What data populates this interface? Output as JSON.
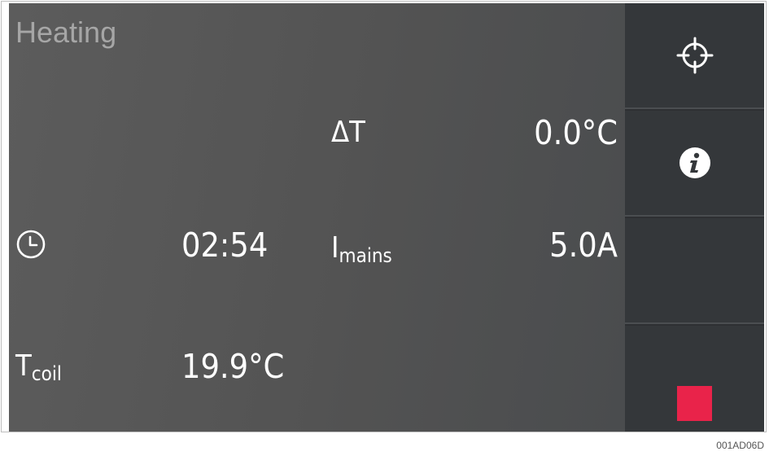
{
  "screen": {
    "title": "Heating",
    "delta_t": {
      "label": "ΔT",
      "value": "0.0°C"
    },
    "timer": {
      "icon": "clock-icon",
      "value": "02:54"
    },
    "mains_current": {
      "label_main": "I",
      "label_sub": "mains",
      "value": "5.0A"
    },
    "coil_temp": {
      "label_main": "T",
      "label_sub": "coil",
      "value": "19.9°C"
    }
  },
  "sidebar": {
    "buttons": [
      {
        "icon": "crosshair-icon"
      },
      {
        "icon": "info-icon"
      },
      {
        "icon": ""
      },
      {
        "icon": "stop-icon",
        "color": "#e9234a"
      }
    ]
  },
  "footer": {
    "figure_code": "001AD06D"
  },
  "colors": {
    "screen_bg": "#555555",
    "sidebar_bg": "#34373a",
    "title_text": "#a6a6a6",
    "stop": "#e9234a"
  }
}
